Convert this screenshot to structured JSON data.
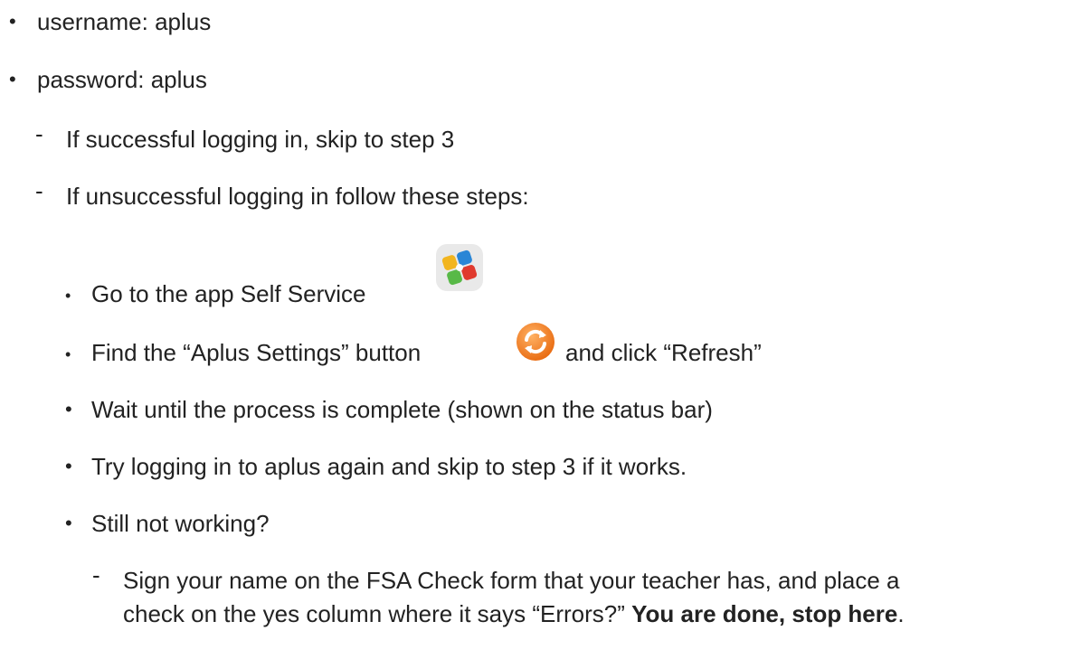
{
  "bullets": {
    "username": "username: aplus",
    "password": "password: aplus"
  },
  "sub": {
    "success": "If successful logging in, skip to step 3",
    "unsuccessful": "If unsuccessful logging in follow these steps:"
  },
  "steps": {
    "self_service": "Go to the app Self Service",
    "find_pre": "Find the “Aplus Settings” button",
    "find_post": "and click “Refresh”",
    "wait": "Wait until the process is complete (shown on the status bar)",
    "retry": "Try logging in to aplus again and skip to step 3 if it works.",
    "still": "Still not working?"
  },
  "final": {
    "line1": "Sign your name on the FSA Check form that your teacher has, and place a",
    "line2_pre": "check on the yes column where it says “Errors?”",
    "line2_bold": "You are done, stop here",
    "line2_end": "."
  },
  "icons": {
    "self_service": "self-service-app-icon",
    "refresh": "orange-refresh-icon"
  },
  "colors": {
    "text": "#222222",
    "refresh_orange": "#f07f1e"
  }
}
